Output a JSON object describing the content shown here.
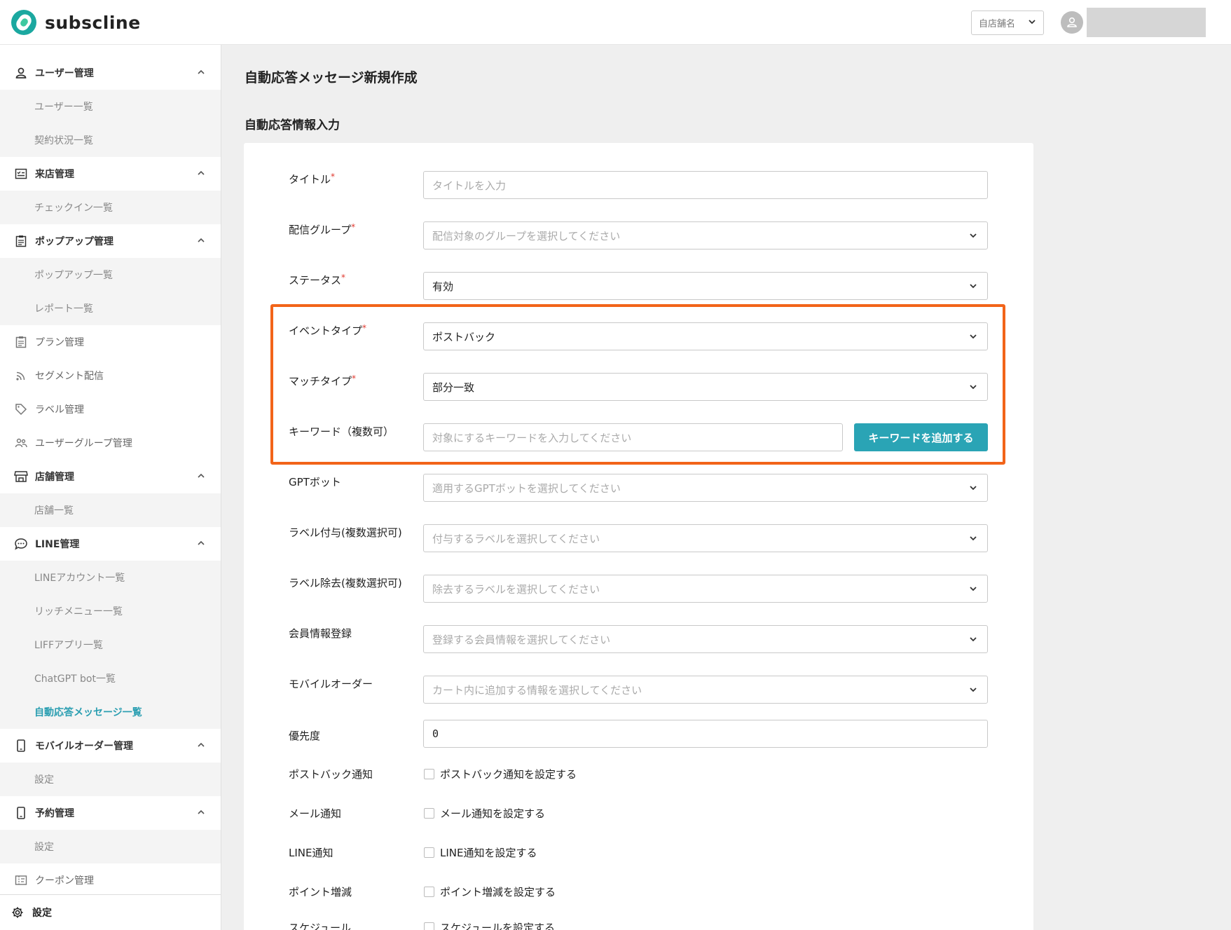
{
  "header": {
    "brand": "subscline",
    "store_select": "自店舗名"
  },
  "sidebar": {
    "sections": [
      {
        "label": "ユーザー管理",
        "icon": "person-icon",
        "children": [
          "ユーザー一覧",
          "契約状況一覧"
        ]
      },
      {
        "label": "来店管理",
        "icon": "checklist-icon",
        "children": [
          "チェックイン一覧"
        ]
      },
      {
        "label": "ポップアップ管理",
        "icon": "clipboard-icon",
        "children": [
          "ポップアップ一覧",
          "レポート一覧"
        ]
      },
      {
        "label": "プラン管理",
        "icon": "clipboard-icon"
      },
      {
        "label": "セグメント配信",
        "icon": "rss-icon"
      },
      {
        "label": "ラベル管理",
        "icon": "tag-icon"
      },
      {
        "label": "ユーザーグループ管理",
        "icon": "group-icon"
      },
      {
        "label": "店舗管理",
        "icon": "store-icon",
        "children": [
          "店舗一覧"
        ]
      },
      {
        "label": "LINE管理",
        "icon": "chat-bubble-icon",
        "children": [
          "LINEアカウント一覧",
          "リッチメニュー一覧",
          "LIFFアプリ一覧",
          "ChatGPT bot一覧",
          "自動応答メッセージ一覧"
        ],
        "active_child": 4
      },
      {
        "label": "モバイルオーダー管理",
        "icon": "mobile-icon",
        "children": [
          "設定"
        ]
      },
      {
        "label": "予約管理",
        "icon": "mobile-icon",
        "children": [
          "設定"
        ]
      },
      {
        "label": "クーポン管理",
        "icon": "ticket-icon"
      }
    ],
    "settings_label": "設定"
  },
  "main": {
    "page_title": "自動応答メッセージ新規作成",
    "section_title": "自動応答情報入力",
    "form": {
      "title": {
        "label": "タイトル",
        "required_mark": "*",
        "placeholder": "タイトルを入力"
      },
      "group": {
        "label": "配信グループ",
        "required_mark": "*",
        "placeholder": "配信対象のグループを選択してください"
      },
      "status": {
        "label": "ステータス",
        "required_mark": "*",
        "value": "有効"
      },
      "event_type": {
        "label": "イベントタイプ",
        "required_mark": "*",
        "value": "ポストバック"
      },
      "match_type": {
        "label": "マッチタイプ",
        "required_mark": "*",
        "value": "部分一致"
      },
      "keyword": {
        "label": "キーワード（複数可）",
        "placeholder": "対象にするキーワードを入力してください",
        "button": "キーワードを追加する"
      },
      "gpt_bot": {
        "label": "GPTボット",
        "placeholder": "適用するGPTボットを選択してください"
      },
      "label_add": {
        "label": "ラベル付与(複数選択可)",
        "placeholder": "付与するラベルを選択してください"
      },
      "label_remove": {
        "label": "ラベル除去(複数選択可)",
        "placeholder": "除去するラベルを選択してください"
      },
      "member_info": {
        "label": "会員情報登録",
        "placeholder": "登録する会員情報を選択してください"
      },
      "mobile_order": {
        "label": "モバイルオーダー",
        "placeholder": "カート内に追加する情報を選択してください"
      },
      "priority": {
        "label": "優先度",
        "value": "0"
      },
      "postback_notify": {
        "label": "ポストバック通知",
        "checkbox": "ポストバック通知を設定する",
        "checked": false
      },
      "mail_notify": {
        "label": "メール通知",
        "checkbox": "メール通知を設定する",
        "checked": false
      },
      "line_notify": {
        "label": "LINE通知",
        "checkbox": "LINE通知を設定する",
        "checked": false
      },
      "point": {
        "label": "ポイント増減",
        "checkbox": "ポイント増減を設定する",
        "checked": false
      },
      "schedule": {
        "label": "スケジュール",
        "checkbox": "スケジュールを設定する",
        "checked": false
      }
    }
  },
  "colors": {
    "accent": "#2aa4b5",
    "highlight": "#f26419",
    "required": "#e0382e",
    "active_nav": "#2a9eb1"
  }
}
